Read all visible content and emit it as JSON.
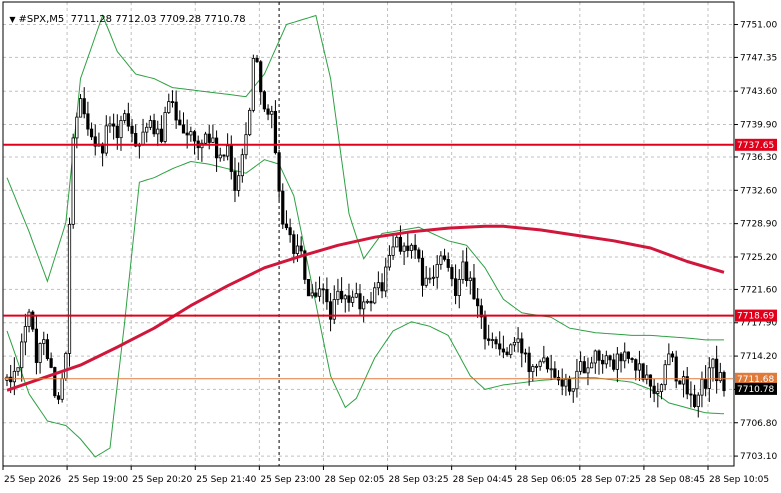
{
  "header": {
    "symbol": "#SPX,M5",
    "ohlc": "7711.28 7712.03 7709.28 7710.78"
  },
  "colors": {
    "background": "#ffffff",
    "axis": "#000000",
    "grid": "#c0c0c0",
    "candle": "#000000",
    "level_line": "#e0001b",
    "ma_line": "#d0163b",
    "bollinger": "#2ea043",
    "bid_line": "#e07a3b"
  },
  "chart_data": {
    "type": "candlestick",
    "symbol": "#SPX,M5",
    "ohlc_last": {
      "open": 7711.28,
      "high": 7712.03,
      "low": 7709.28,
      "close": 7710.78
    },
    "ylim": [
      7702.0,
      7753.5
    ],
    "y_ticks": [
      7751.0,
      7747.35,
      7743.6,
      7739.9,
      7736.3,
      7732.6,
      7728.9,
      7725.2,
      7721.6,
      7717.9,
      7714.2,
      7710.5,
      7706.8,
      7703.1
    ],
    "x_ticks": [
      "25 Sep 2026",
      "25 Sep 19:00",
      "25 Sep 20:20",
      "25 Sep 21:40",
      "25 Sep 23:00",
      "28 Sep 02:05",
      "28 Sep 03:25",
      "28 Sep 04:45",
      "28 Sep 06:05",
      "28 Sep 07:25",
      "28 Sep 08:45",
      "28 Sep 10:05"
    ],
    "grid": true,
    "horizontal_levels": [
      {
        "value": 7737.65,
        "label": "7737.65"
      },
      {
        "value": 7718.69,
        "label": "7718.69"
      }
    ],
    "bid_line": {
      "value": 7711.68,
      "label": "7711.68"
    },
    "current_price": {
      "value": 7710.78,
      "label": "7710.78"
    },
    "session_separator_index": 74,
    "moving_average": [
      {
        "i": 0,
        "v": 7710.4
      },
      {
        "i": 10,
        "v": 7711.8
      },
      {
        "i": 20,
        "v": 7713.2
      },
      {
        "i": 30,
        "v": 7715.2
      },
      {
        "i": 40,
        "v": 7717.3
      },
      {
        "i": 50,
        "v": 7719.8
      },
      {
        "i": 60,
        "v": 7722.0
      },
      {
        "i": 70,
        "v": 7724.0
      },
      {
        "i": 80,
        "v": 7725.3
      },
      {
        "i": 90,
        "v": 7726.5
      },
      {
        "i": 100,
        "v": 7727.4
      },
      {
        "i": 110,
        "v": 7728.0
      },
      {
        "i": 120,
        "v": 7728.4
      },
      {
        "i": 130,
        "v": 7728.6
      },
      {
        "i": 135,
        "v": 7728.6
      },
      {
        "i": 145,
        "v": 7728.2
      },
      {
        "i": 155,
        "v": 7727.6
      },
      {
        "i": 165,
        "v": 7727.0
      },
      {
        "i": 175,
        "v": 7726.2
      },
      {
        "i": 185,
        "v": 7724.7
      },
      {
        "i": 195,
        "v": 7723.5
      }
    ],
    "bollinger_upper": [
      {
        "i": 0,
        "v": 7734.0
      },
      {
        "i": 6,
        "v": 7728.0
      },
      {
        "i": 11,
        "v": 7722.5
      },
      {
        "i": 16,
        "v": 7729.0
      },
      {
        "i": 20,
        "v": 7745.0
      },
      {
        "i": 26,
        "v": 7752.0
      },
      {
        "i": 30,
        "v": 7748.0
      },
      {
        "i": 35,
        "v": 7745.5
      },
      {
        "i": 40,
        "v": 7745.0
      },
      {
        "i": 45,
        "v": 7744.0
      },
      {
        "i": 55,
        "v": 7743.5
      },
      {
        "i": 65,
        "v": 7743.0
      },
      {
        "i": 70,
        "v": 7745.5
      },
      {
        "i": 76,
        "v": 7751.0
      },
      {
        "i": 84,
        "v": 7752.0
      },
      {
        "i": 88,
        "v": 7745.0
      },
      {
        "i": 93,
        "v": 7730.0
      },
      {
        "i": 97,
        "v": 7725.0
      },
      {
        "i": 102,
        "v": 7727.8
      },
      {
        "i": 112,
        "v": 7728.5
      },
      {
        "i": 120,
        "v": 7727.0
      },
      {
        "i": 125,
        "v": 7726.5
      },
      {
        "i": 130,
        "v": 7724.0
      },
      {
        "i": 135,
        "v": 7720.5
      },
      {
        "i": 140,
        "v": 7719.0
      },
      {
        "i": 148,
        "v": 7718.5
      },
      {
        "i": 153,
        "v": 7717.3
      },
      {
        "i": 160,
        "v": 7716.8
      },
      {
        "i": 170,
        "v": 7716.5
      },
      {
        "i": 175,
        "v": 7716.5
      },
      {
        "i": 185,
        "v": 7716.2
      },
      {
        "i": 190,
        "v": 7716.0
      },
      {
        "i": 195,
        "v": 7716.0
      }
    ],
    "bollinger_lower": [
      {
        "i": 0,
        "v": 7717.0
      },
      {
        "i": 6,
        "v": 7710.0
      },
      {
        "i": 11,
        "v": 7707.0
      },
      {
        "i": 16,
        "v": 7706.5
      },
      {
        "i": 20,
        "v": 7705.0
      },
      {
        "i": 24,
        "v": 7703.0
      },
      {
        "i": 28,
        "v": 7704.0
      },
      {
        "i": 32,
        "v": 7718.0
      },
      {
        "i": 36,
        "v": 7733.5
      },
      {
        "i": 40,
        "v": 7734.0
      },
      {
        "i": 45,
        "v": 7735.0
      },
      {
        "i": 50,
        "v": 7735.8
      },
      {
        "i": 55,
        "v": 7735.5
      },
      {
        "i": 60,
        "v": 7735.0
      },
      {
        "i": 65,
        "v": 7734.5
      },
      {
        "i": 70,
        "v": 7736.0
      },
      {
        "i": 74,
        "v": 7735.5
      },
      {
        "i": 78,
        "v": 7732.0
      },
      {
        "i": 84,
        "v": 7720.0
      },
      {
        "i": 88,
        "v": 7712.0
      },
      {
        "i": 92,
        "v": 7708.5
      },
      {
        "i": 95,
        "v": 7709.5
      },
      {
        "i": 100,
        "v": 7714.0
      },
      {
        "i": 105,
        "v": 7717.0
      },
      {
        "i": 110,
        "v": 7718.0
      },
      {
        "i": 115,
        "v": 7717.5
      },
      {
        "i": 120,
        "v": 7716.5
      },
      {
        "i": 126,
        "v": 7712.0
      },
      {
        "i": 130,
        "v": 7710.5
      },
      {
        "i": 135,
        "v": 7711.0
      },
      {
        "i": 145,
        "v": 7711.5
      },
      {
        "i": 155,
        "v": 7711.8
      },
      {
        "i": 160,
        "v": 7711.8
      },
      {
        "i": 170,
        "v": 7711.3
      },
      {
        "i": 175,
        "v": 7710.5
      },
      {
        "i": 180,
        "v": 7709.0
      },
      {
        "i": 190,
        "v": 7707.9
      },
      {
        "i": 195,
        "v": 7707.8
      }
    ],
    "price_path": [
      {
        "i": 0,
        "v": 7711.5
      },
      {
        "i": 2,
        "v": 7712.0
      },
      {
        "i": 4,
        "v": 7716.0
      },
      {
        "i": 6,
        "v": 7719.5
      },
      {
        "i": 8,
        "v": 7713.0
      },
      {
        "i": 10,
        "v": 7717.0
      },
      {
        "i": 12,
        "v": 7712.5
      },
      {
        "i": 14,
        "v": 7709.0
      },
      {
        "i": 16,
        "v": 7714.0
      },
      {
        "i": 17,
        "v": 7728.0
      },
      {
        "i": 18,
        "v": 7738.0
      },
      {
        "i": 20,
        "v": 7742.0
      },
      {
        "i": 22,
        "v": 7740.0
      },
      {
        "i": 24,
        "v": 7738.5
      },
      {
        "i": 26,
        "v": 7737.0
      },
      {
        "i": 28,
        "v": 7740.5
      },
      {
        "i": 30,
        "v": 7738.0
      },
      {
        "i": 32,
        "v": 7741.5
      },
      {
        "i": 34,
        "v": 7738.0
      },
      {
        "i": 36,
        "v": 7738.5
      },
      {
        "i": 38,
        "v": 7740.0
      },
      {
        "i": 40,
        "v": 7738.5
      },
      {
        "i": 42,
        "v": 7739.0
      },
      {
        "i": 44,
        "v": 7742.0
      },
      {
        "i": 46,
        "v": 7741.0
      },
      {
        "i": 48,
        "v": 7740.0
      },
      {
        "i": 50,
        "v": 7738.5
      },
      {
        "i": 52,
        "v": 7737.0
      },
      {
        "i": 54,
        "v": 7739.0
      },
      {
        "i": 56,
        "v": 7737.5
      },
      {
        "i": 58,
        "v": 7736.0
      },
      {
        "i": 60,
        "v": 7736.5
      },
      {
        "i": 62,
        "v": 7733.0
      },
      {
        "i": 64,
        "v": 7737.0
      },
      {
        "i": 66,
        "v": 7741.0
      },
      {
        "i": 67,
        "v": 7748.0
      },
      {
        "i": 68,
        "v": 7747.0
      },
      {
        "i": 70,
        "v": 7742.0
      },
      {
        "i": 72,
        "v": 7740.5
      },
      {
        "i": 74,
        "v": 7731.5
      },
      {
        "i": 76,
        "v": 7728.0
      },
      {
        "i": 78,
        "v": 7726.5
      },
      {
        "i": 80,
        "v": 7725.0
      },
      {
        "i": 82,
        "v": 7721.0
      },
      {
        "i": 84,
        "v": 7720.0
      },
      {
        "i": 86,
        "v": 7721.5
      },
      {
        "i": 88,
        "v": 7719.0
      },
      {
        "i": 90,
        "v": 7720.5
      },
      {
        "i": 92,
        "v": 7720.0
      },
      {
        "i": 94,
        "v": 7721.0
      },
      {
        "i": 96,
        "v": 7720.0
      },
      {
        "i": 98,
        "v": 7719.5
      },
      {
        "i": 100,
        "v": 7722.0
      },
      {
        "i": 102,
        "v": 7722.0
      },
      {
        "i": 104,
        "v": 7725.0
      },
      {
        "i": 106,
        "v": 7727.5
      },
      {
        "i": 108,
        "v": 7726.0
      },
      {
        "i": 110,
        "v": 7726.0
      },
      {
        "i": 112,
        "v": 7724.0
      },
      {
        "i": 114,
        "v": 7722.0
      },
      {
        "i": 116,
        "v": 7723.0
      },
      {
        "i": 118,
        "v": 7725.0
      },
      {
        "i": 120,
        "v": 7723.5
      },
      {
        "i": 122,
        "v": 7722.0
      },
      {
        "i": 124,
        "v": 7725.0
      },
      {
        "i": 126,
        "v": 7722.0
      },
      {
        "i": 128,
        "v": 7719.0
      },
      {
        "i": 130,
        "v": 7717.0
      },
      {
        "i": 132,
        "v": 7716.0
      },
      {
        "i": 134,
        "v": 7715.0
      },
      {
        "i": 136,
        "v": 7714.5
      },
      {
        "i": 138,
        "v": 7715.5
      },
      {
        "i": 140,
        "v": 7715.0
      },
      {
        "i": 142,
        "v": 7713.5
      },
      {
        "i": 144,
        "v": 7714.0
      },
      {
        "i": 146,
        "v": 7714.5
      },
      {
        "i": 148,
        "v": 7713.0
      },
      {
        "i": 150,
        "v": 7712.5
      },
      {
        "i": 152,
        "v": 7711.0
      },
      {
        "i": 154,
        "v": 7711.5
      },
      {
        "i": 156,
        "v": 7713.0
      },
      {
        "i": 158,
        "v": 7713.5
      },
      {
        "i": 160,
        "v": 7714.5
      },
      {
        "i": 162,
        "v": 7714.0
      },
      {
        "i": 164,
        "v": 7713.0
      },
      {
        "i": 166,
        "v": 7713.5
      },
      {
        "i": 168,
        "v": 7714.5
      },
      {
        "i": 170,
        "v": 7713.0
      },
      {
        "i": 172,
        "v": 7712.5
      },
      {
        "i": 174,
        "v": 7711.5
      },
      {
        "i": 176,
        "v": 7710.5
      },
      {
        "i": 178,
        "v": 7711.0
      },
      {
        "i": 180,
        "v": 7715.0
      },
      {
        "i": 182,
        "v": 7712.5
      },
      {
        "i": 184,
        "v": 7711.0
      },
      {
        "i": 186,
        "v": 7709.0
      },
      {
        "i": 188,
        "v": 7710.0
      },
      {
        "i": 190,
        "v": 7711.5
      },
      {
        "i": 192,
        "v": 7713.0
      },
      {
        "i": 194,
        "v": 7711.5
      },
      {
        "i": 195,
        "v": 7710.8
      }
    ],
    "candle_count": 196
  }
}
